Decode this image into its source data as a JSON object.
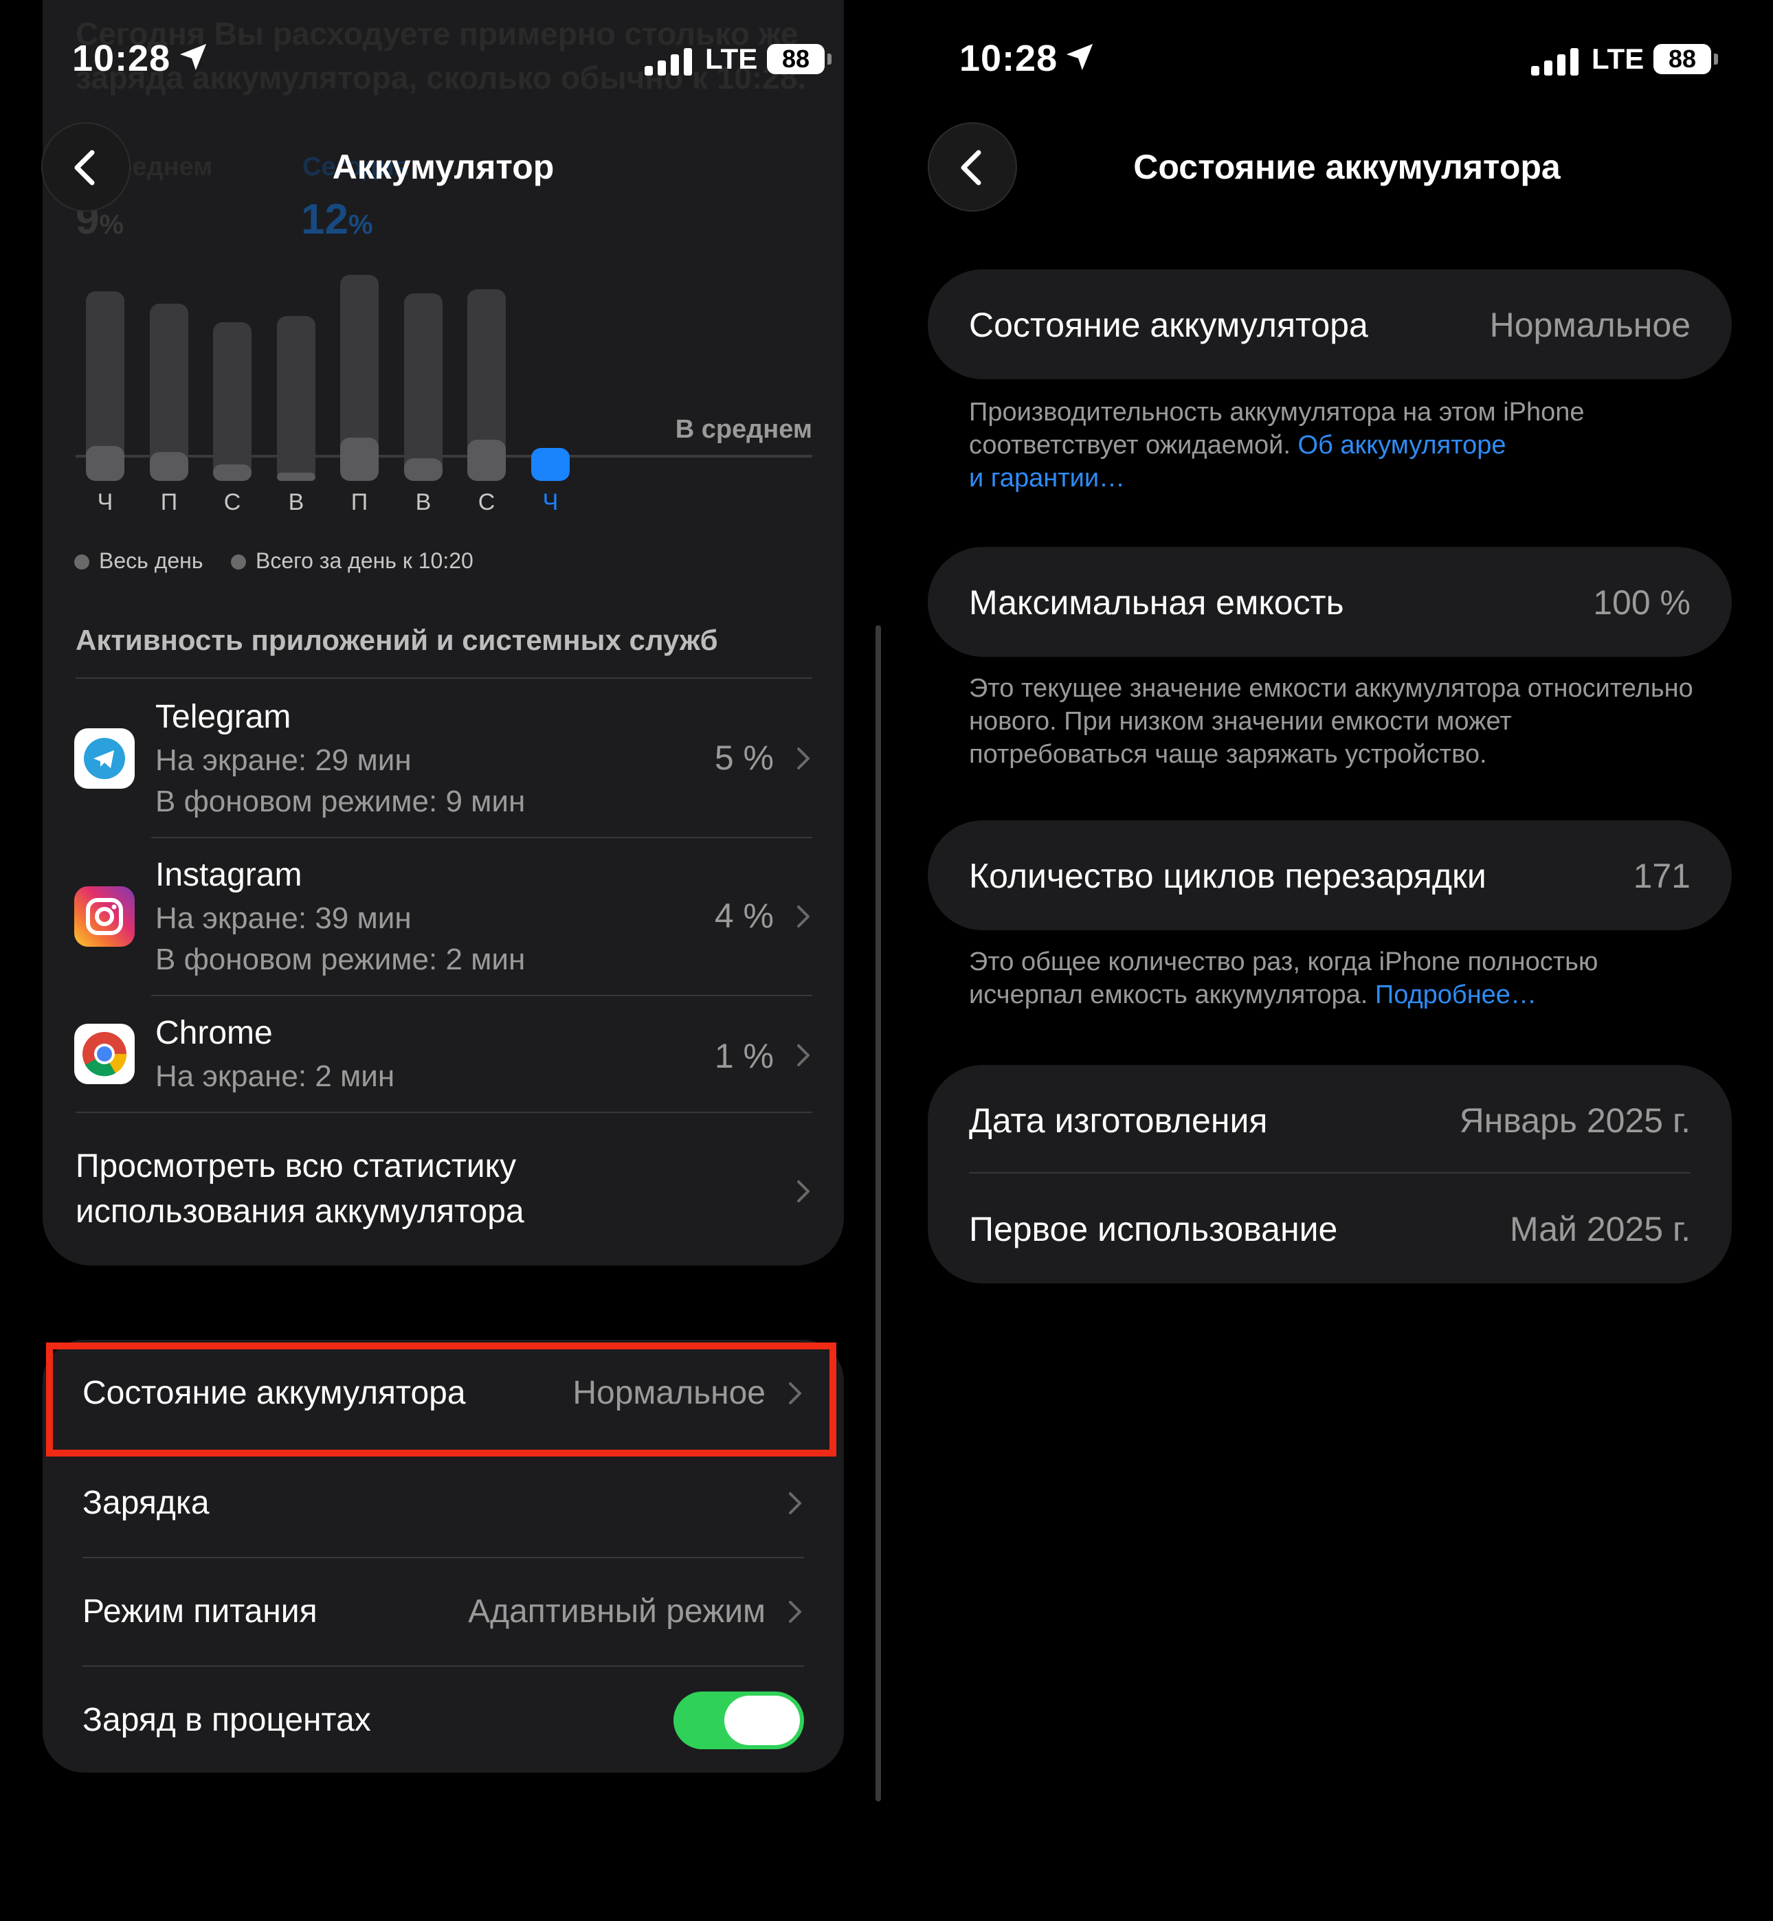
{
  "status_bar": {
    "time": "10:28",
    "network": "LTE",
    "battery": "88"
  },
  "left": {
    "nav": {
      "title": "Аккумулятор"
    },
    "ghost_text": {
      "line1": "Сегодня Вы расходуете примерно столько же",
      "line2": "заряда аккумулятора, сколько обычно к 10:28.",
      "avg_label": "В среднем",
      "today_label": "Сегодня",
      "avg_value": "9",
      "today_value": "12",
      "unit": "%"
    },
    "chart": {
      "average_label": "В среднем",
      "days": [
        "Ч",
        "П",
        "С",
        "В",
        "П",
        "В",
        "С",
        "Ч"
      ],
      "legend": {
        "all_day": "Весь день",
        "total_by": "Всего за день к 10:20"
      },
      "accent_color": "#1a84ff"
    },
    "chart_data": {
      "type": "bar",
      "categories": [
        "Ч",
        "П",
        "С",
        "В",
        "П",
        "В",
        "С",
        "Ч"
      ],
      "series": [
        {
          "name": "Весь день",
          "values": [
            0.92,
            0.86,
            0.77,
            0.8,
            1.0,
            0.91,
            0.93,
            0
          ]
        },
        {
          "name": "Всего за день к 10:20",
          "values": [
            0.17,
            0.14,
            0.08,
            0.03,
            0.21,
            0.11,
            0.2,
            0.16
          ]
        }
      ]
    },
    "apps_section": {
      "header": "Активность приложений и системных служб",
      "apps": [
        {
          "name": "Telegram",
          "screen": "На экране: 29 мин",
          "background": "В фоновом режиме: 9 мин",
          "percent": "5 %"
        },
        {
          "name": "Instagram",
          "screen": "На экране: 39 мин",
          "background": "В фоновом режиме: 2 мин",
          "percent": "4 %"
        },
        {
          "name": "Chrome",
          "screen": "На экране: 2 мин",
          "percent": "1 %"
        }
      ],
      "view_all_line1": "Просмотреть всю статистику",
      "view_all_line2": "использования аккумулятора"
    },
    "settings": {
      "health_label": "Состояние аккумулятора",
      "health_value": "Нормальное",
      "charging_label": "Зарядка",
      "power_mode_label": "Режим питания",
      "power_mode_value": "Адаптивный режим",
      "percentage_label": "Заряд в процентах",
      "percentage_on": true
    }
  },
  "right": {
    "nav": {
      "title": "Состояние аккумулятора"
    },
    "health": {
      "label": "Состояние аккумулятора",
      "value": "Нормальное",
      "note": "Производительность аккумулятора на этом iPhone соответствует ожидаемой.",
      "link_part1": "Об аккумуляторе",
      "link_part2": "и гарантии…"
    },
    "capacity": {
      "label": "Максимальная емкость",
      "value": "100 %",
      "note": "Это текущее значение емкости аккумулятора относительно нового. При низком значении емкости может потребоваться чаще заряжать устройство."
    },
    "cycles": {
      "label": "Количество циклов перезарядки",
      "value": "171",
      "note": "Это общее количество раз, когда iPhone полностью исчерпал емкость аккумулятора.",
      "link": "Подробнее…"
    },
    "dates": {
      "manufacture_label": "Дата изготовления",
      "manufacture_value": "Январь 2025 г.",
      "first_use_label": "Первое использование",
      "first_use_value": "Май 2025 г."
    }
  }
}
